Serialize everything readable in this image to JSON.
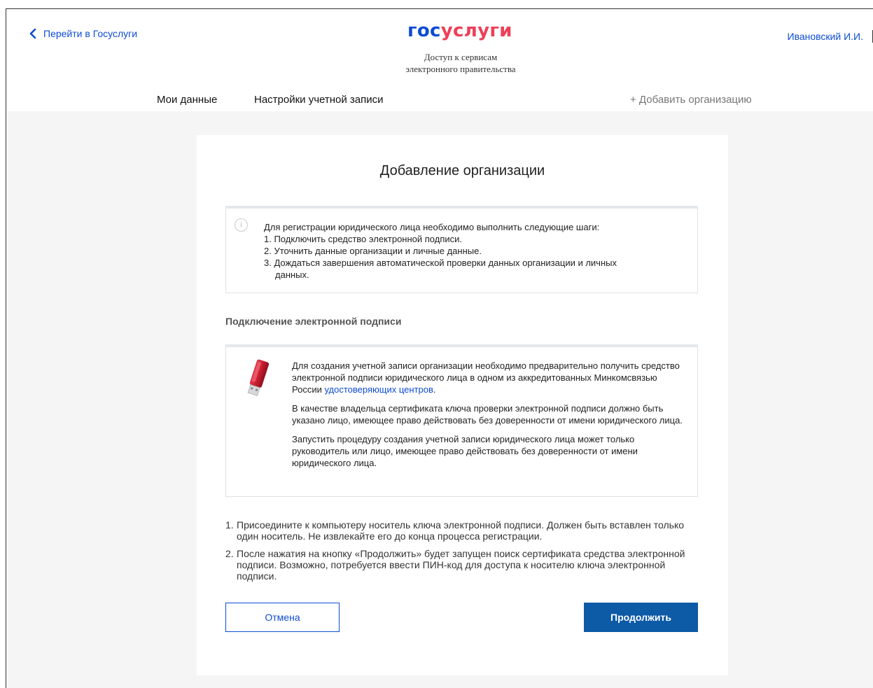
{
  "header": {
    "back_link_label": "Перейти в Госуслуги",
    "logo_part1": "гос",
    "logo_part2": "услуги",
    "tagline_line1": "Доступ к сервисам",
    "tagline_line2": "электронного правительства",
    "user_name": "Ивановский И.И."
  },
  "nav": {
    "my_data": "Мои данные",
    "account_settings": "Настройки учетной записи",
    "add_organization": "+ Добавить организацию"
  },
  "card": {
    "title": "Добавление организации",
    "info": {
      "icon_label": "i",
      "intro": "Для регистрации юридического лица необходимо выполнить следующие шаги:",
      "steps": [
        "1. Подключить средство электронной подписи.",
        "2. Уточнить данные организации и личные данные.",
        "3. Дождаться завершения автоматической проверки данных организации и личных",
        "данных."
      ]
    },
    "section_title": "Подключение электронной подписи",
    "sign": {
      "p1_text": "Для создания учетной записи организации необходимо предварительно получить средство электронной подписи юридического лица в одном из аккредитованных Минкомсвязью России ",
      "p1_link": "удостоверяющих центров",
      "p1_end": ".",
      "p2": "В качестве владельца сертификата ключа проверки электронной подписи должно быть указано лицо, имеющее право действовать без доверенности от имени юридического лица.",
      "p3": "Запустить процедуру создания учетной записи юридического лица может только руководитель или лицо, имеющее право действовать без доверенности от имени юридического лица."
    },
    "steps": [
      {
        "num": "1.",
        "text": "Присоедините к компьютеру носитель ключа электронной подписи. Должен быть вставлен только один носитель. Не извлекайте его до конца процесса регистрации."
      },
      {
        "num": "2.",
        "text": "После нажатия на кнопку «Продолжить» будет запущен поиск сертификата средства электронной подписи. Возможно, потребуется ввести ПИН-код для доступа к носителю ключа электронной подписи."
      }
    ],
    "cancel_label": "Отмена",
    "continue_label": "Продолжить"
  },
  "colors": {
    "brand_blue": "#0d4cd3",
    "brand_red": "#ee3f58",
    "button_blue": "#0d5aa7",
    "page_gray": "#f5f5f5"
  }
}
